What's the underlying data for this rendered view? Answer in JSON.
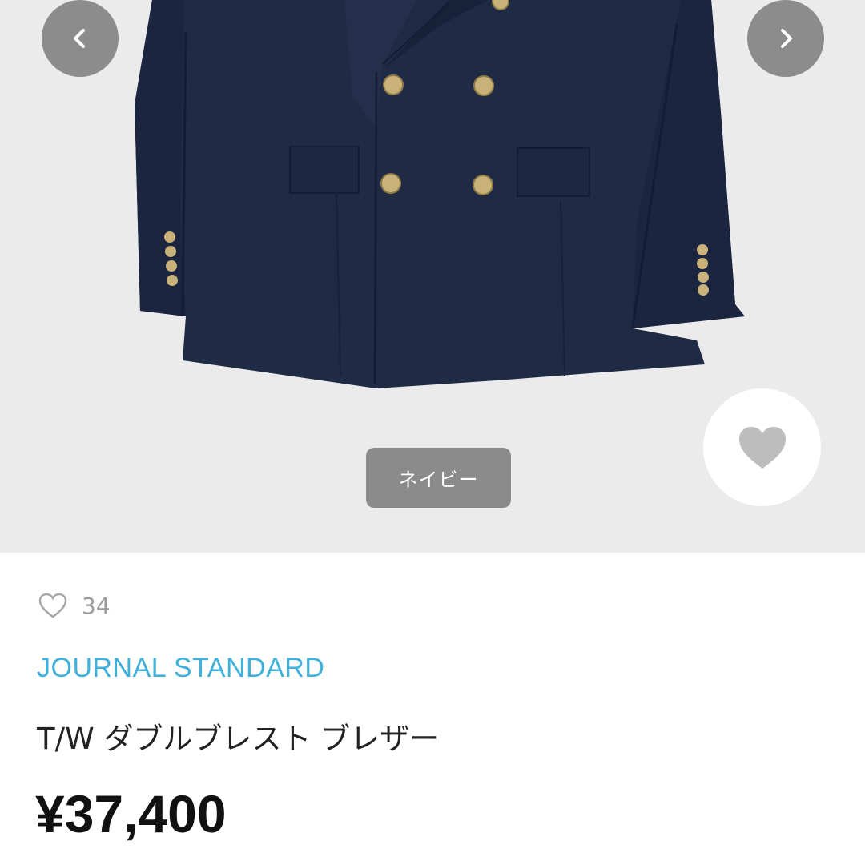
{
  "gallery": {
    "color_label": "ネイビー",
    "prev_icon": "chevron-left-icon",
    "next_icon": "chevron-right-icon",
    "favorite_icon": "heart-icon",
    "image": "navy-double-breasted-blazer",
    "colors": {
      "background": "#ebebeb",
      "jacket": "#1f2a44",
      "buttons": "#c8b27a",
      "nav_button": "#8c8c8c"
    }
  },
  "product": {
    "likes_icon": "heart-outline-icon",
    "likes_count": "34",
    "brand": "JOURNAL STANDARD",
    "name": "T/W ダブルブレスト ブレザー",
    "price": "¥37,400",
    "brand_color": "#3fb1da"
  }
}
